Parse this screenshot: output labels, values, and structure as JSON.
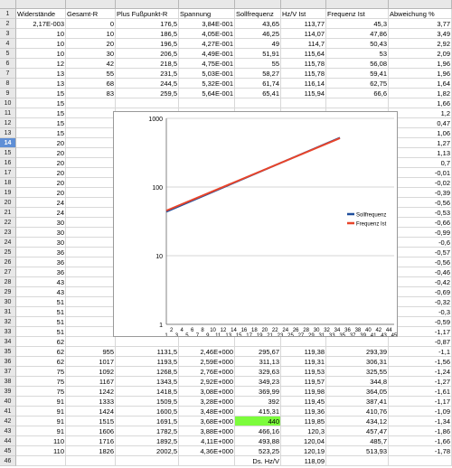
{
  "columns": [
    "A",
    "B",
    "C",
    "D",
    "E",
    "F",
    "G",
    "H"
  ],
  "headers": [
    "Widerstände",
    "Gesamt-R",
    "Plus Fußpunkt-R",
    "Spannung",
    "Sollfrequenz",
    "Hz/V Ist",
    "Frequenz Ist",
    "Abweichung %"
  ],
  "selected_row": 14,
  "rows": [
    [
      "2,17E-003",
      "0",
      "176,5",
      "3,84E-001",
      "43,65",
      "113,77",
      "45,3",
      "3,77"
    ],
    [
      "10",
      "10",
      "186,5",
      "4,05E-001",
      "46,25",
      "114,07",
      "47,86",
      "3,49"
    ],
    [
      "10",
      "20",
      "196,5",
      "4,27E-001",
      "49",
      "114,7",
      "50,43",
      "2,92"
    ],
    [
      "10",
      "30",
      "206,5",
      "4,49E-001",
      "51,91",
      "115,64",
      "53",
      "2,09"
    ],
    [
      "12",
      "42",
      "218,5",
      "4,75E-001",
      "55",
      "115,78",
      "56,08",
      "1,96"
    ],
    [
      "13",
      "55",
      "231,5",
      "5,03E-001",
      "58,27",
      "115,78",
      "59,41",
      "1,96"
    ],
    [
      "13",
      "68",
      "244,5",
      "5,32E-001",
      "61,74",
      "116,14",
      "62,75",
      "1,64"
    ],
    [
      "15",
      "83",
      "259,5",
      "5,64E-001",
      "65,41",
      "115,94",
      "66,6",
      "1,82"
    ],
    [
      "15",
      "",
      "",
      "",
      "",
      "",
      "",
      "1,66"
    ],
    [
      "15",
      "",
      "",
      "",
      "",
      "",
      "",
      "1,2"
    ],
    [
      "15",
      "",
      "",
      "",
      "",
      "",
      "",
      "0,47"
    ],
    [
      "15",
      "",
      "",
      "",
      "",
      "",
      "",
      "1,06"
    ],
    [
      "20",
      "",
      "",
      "",
      "",
      "",
      "",
      "1,27"
    ],
    [
      "20",
      "",
      "",
      "",
      "",
      "",
      "",
      "1,13"
    ],
    [
      "20",
      "",
      "",
      "",
      "",
      "",
      "",
      "0,7"
    ],
    [
      "20",
      "",
      "",
      "",
      "",
      "",
      "",
      "-0,01"
    ],
    [
      "20",
      "",
      "",
      "",
      "",
      "",
      "",
      "-0,02"
    ],
    [
      "20",
      "",
      "",
      "",
      "",
      "",
      "",
      "-0,39"
    ],
    [
      "24",
      "",
      "",
      "",
      "",
      "",
      "",
      "-0,56"
    ],
    [
      "24",
      "",
      "",
      "",
      "",
      "",
      "",
      "-0,53"
    ],
    [
      "30",
      "",
      "",
      "",
      "",
      "",
      "",
      "-0,66"
    ],
    [
      "30",
      "",
      "",
      "",
      "",
      "",
      "",
      "-0,99"
    ],
    [
      "30",
      "",
      "",
      "",
      "",
      "",
      "",
      "-0,6"
    ],
    [
      "36",
      "",
      "",
      "",
      "",
      "",
      "",
      "-0,57"
    ],
    [
      "36",
      "",
      "",
      "",
      "",
      "",
      "",
      "-0,56"
    ],
    [
      "36",
      "",
      "",
      "",
      "",
      "",
      "",
      "-0,46"
    ],
    [
      "43",
      "",
      "",
      "",
      "",
      "",
      "",
      "-0,42"
    ],
    [
      "43",
      "",
      "",
      "",
      "",
      "",
      "",
      "-0,69"
    ],
    [
      "51",
      "",
      "",
      "",
      "",
      "",
      "",
      "-0,32"
    ],
    [
      "51",
      "",
      "",
      "",
      "",
      "",
      "",
      "-0,3"
    ],
    [
      "51",
      "",
      "",
      "",
      "",
      "",
      "",
      "-0,59"
    ],
    [
      "51",
      "",
      "",
      "",
      "",
      "",
      "",
      "-1,17"
    ],
    [
      "62",
      "",
      "",
      "",
      "",
      "",
      "",
      "-0,87"
    ],
    [
      "62",
      "955",
      "1131,5",
      "2,46E+000",
      "295,67",
      "119,38",
      "293,39",
      "-1,1"
    ],
    [
      "62",
      "1017",
      "1193,5",
      "2,59E+000",
      "311,13",
      "119,31",
      "306,31",
      "-1,56"
    ],
    [
      "75",
      "1092",
      "1268,5",
      "2,76E+000",
      "329,63",
      "119,53",
      "325,55",
      "-1,24"
    ],
    [
      "75",
      "1167",
      "1343,5",
      "2,92E+000",
      "349,23",
      "119,57",
      "344,8",
      "-1,27"
    ],
    [
      "75",
      "1242",
      "1418,5",
      "3,08E+000",
      "369,99",
      "119,98",
      "364,05",
      "-1,61"
    ],
    [
      "91",
      "1333",
      "1509,5",
      "3,28E+000",
      "392",
      "119,45",
      "387,41",
      "-1,17"
    ],
    [
      "91",
      "1424",
      "1600,5",
      "3,48E+000",
      "415,31",
      "119,36",
      "410,76",
      "-1,09"
    ],
    [
      "91",
      "1515",
      "1691,5",
      "3,68E+000",
      "440",
      "119,85",
      "434,12",
      "-1,34"
    ],
    [
      "91",
      "1606",
      "1782,5",
      "3,88E+000",
      "466,16",
      "120,3",
      "457,47",
      "-1,86"
    ],
    [
      "110",
      "1716",
      "1892,5",
      "4,11E+000",
      "493,88",
      "120,04",
      "485,7",
      "-1,66"
    ],
    [
      "110",
      "1826",
      "2002,5",
      "4,36E+000",
      "523,25",
      "120,19",
      "513,93",
      "-1,78"
    ],
    [
      "",
      "",
      "",
      "",
      "Ds. Hz/V",
      "118,09",
      "",
      ""
    ]
  ],
  "highlight": {
    "row": 41,
    "col": 4,
    "color": "#7cfc3c"
  },
  "chart_data": {
    "type": "line",
    "x": [
      1,
      2,
      3,
      4,
      5,
      6,
      7,
      8,
      9,
      10,
      11,
      12,
      13,
      14,
      15,
      16,
      17,
      18,
      19,
      20,
      21,
      22,
      23,
      24,
      25,
      26,
      27,
      28,
      29,
      30,
      31,
      32,
      33,
      34,
      35,
      36,
      37,
      38,
      39,
      40,
      41,
      42,
      43,
      44,
      45
    ],
    "xtick_labels_top": [
      "2",
      "4",
      "6",
      "8",
      "10",
      "12",
      "14",
      "16",
      "18",
      "20",
      "22",
      "24",
      "26",
      "28",
      "30",
      "32",
      "34",
      "36",
      "38",
      "40",
      "42",
      "44"
    ],
    "xtick_labels_bottom": [
      "1",
      "3",
      "5",
      "7",
      "9",
      "11",
      "13",
      "15",
      "17",
      "19",
      "21",
      "23",
      "25",
      "27",
      "29",
      "31",
      "33",
      "35",
      "37",
      "39",
      "41",
      "43",
      "45"
    ],
    "yscale": "log",
    "ylim": [
      1,
      1000
    ],
    "ytick_labels": [
      "1",
      "10",
      "100",
      "1000"
    ],
    "grid": true,
    "legend_position": "right",
    "series": [
      {
        "name": "Sollfrequenz",
        "color": "#1f4e9c",
        "start": 43.65,
        "end": 523.25
      },
      {
        "name": "Frequenz Ist",
        "color": "#e8442a",
        "start": 45.3,
        "end": 513.93
      }
    ]
  }
}
